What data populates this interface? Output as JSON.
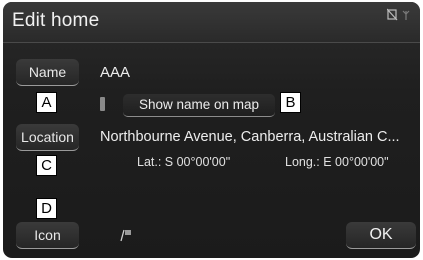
{
  "header": {
    "title": "Edit home",
    "status_icons": [
      "no-signal-icon",
      "antenna-icon"
    ]
  },
  "fields": {
    "name": {
      "button_label": "Name",
      "value": "AAA"
    },
    "location": {
      "button_label": "Location",
      "value": "Northbourne Avenue, Canberra, Australian C...",
      "lat": "Lat.: S 00°00'00\"",
      "long": "Long.: E 00°00'00\""
    },
    "icon": {
      "button_label": "Icon",
      "current_icon": "home-pin-icon"
    }
  },
  "show_name_on_map": {
    "label": "Show name on map"
  },
  "ok_label": "OK",
  "callouts": {
    "a": "A",
    "b": "B",
    "c": "C",
    "d": "D"
  }
}
